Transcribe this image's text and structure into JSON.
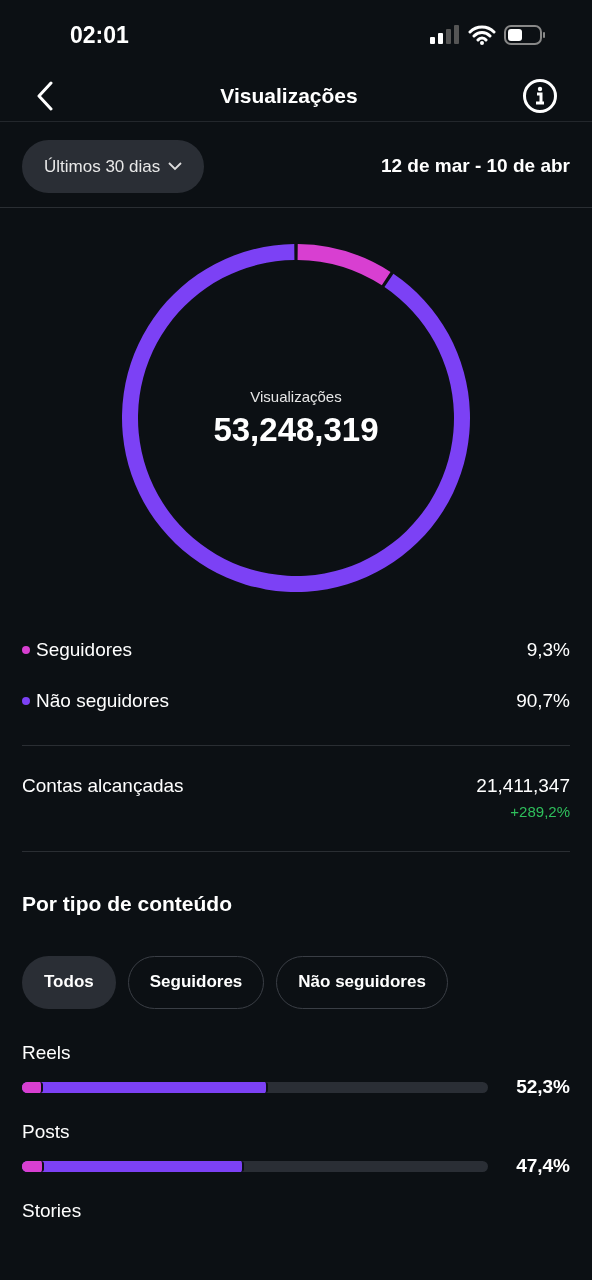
{
  "status_bar": {
    "time": "02:01"
  },
  "header": {
    "title": "Visualizações"
  },
  "filter": {
    "period": "Últimos 30 dias",
    "range": "12 de mar - 10 de abr"
  },
  "summary": {
    "label": "Visualizações",
    "total": "53,248,319",
    "chart_data": {
      "type": "donut",
      "categories": [
        "Seguidores",
        "Não seguidores"
      ],
      "values": [
        9.3,
        90.7
      ]
    }
  },
  "legend": [
    {
      "value": "9,3%",
      "color": "#d83fd1"
    },
    {
      "value": "90,7%",
      "color": "#7c41f5"
    }
  ],
  "accounts": {
    "label": "Contas alcançadas",
    "value": "21,411,347",
    "change": "+289,2%"
  },
  "content_type": {
    "title": "Por tipo de conteúdo",
    "tabs": [
      {
        "label": "Todos",
        "selected": true
      },
      {
        "label": "Seguidores",
        "selected": false
      },
      {
        "label": "Não seguidores",
        "selected": false
      }
    ],
    "rows": [
      {
        "label": "Reels",
        "value": "52,3%",
        "segments": [
          {
            "level": 0.045,
            "color": "#d83fd1"
          },
          {
            "level": 0.527,
            "color": "#7c41f5"
          }
        ]
      },
      {
        "label": "Posts",
        "value": "47,4%",
        "segments": [
          {
            "level": 0.047,
            "color": "#d83fd1"
          },
          {
            "level": 0.477,
            "color": "#7c41f5"
          }
        ]
      },
      {
        "label": "Stories"
      }
    ]
  }
}
